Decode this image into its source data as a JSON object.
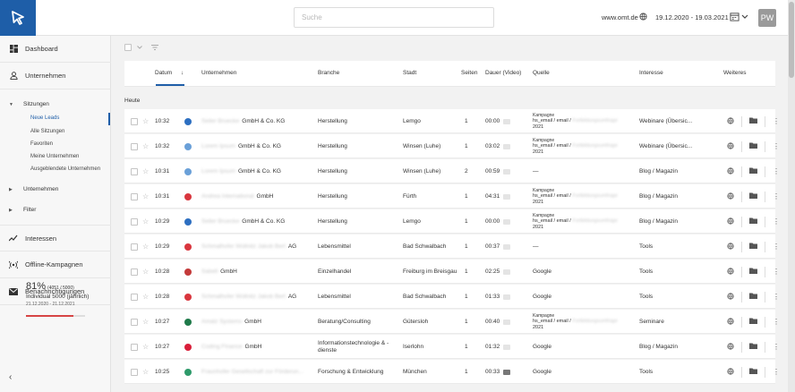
{
  "header": {
    "search_placeholder": "Suche",
    "site": "www.omt.de",
    "date_range": "19.12.2020 - 19.03.2021",
    "avatar_initials": "PW"
  },
  "sidebar": {
    "main_items": [
      {
        "label": "Dashboard",
        "icon": "dashboard-icon"
      },
      {
        "label": "Unternehmen",
        "icon": "person-icon"
      }
    ],
    "sitzungen": {
      "label": "Sitzungen",
      "items": [
        "Neue Leads",
        "Alle Sitzungen",
        "Favoriten",
        "Meine Unternehmen",
        "Ausgeblendete Unternehmen"
      ]
    },
    "unternehmen_sub": "Unternehmen",
    "filter": "Filter",
    "bottom_items": [
      {
        "label": "Interessen",
        "icon": "trend-icon"
      },
      {
        "label": "Offline-Kampagnen",
        "icon": "broadcast-icon"
      },
      {
        "label": "Benachrichtigungen",
        "icon": "mail-icon"
      }
    ],
    "quota": {
      "percent": "81%",
      "count": "(4051 / 5000)",
      "plan": "Individual 5000 (jährlich)",
      "dates": "21.12.2020 - 21.12.2021",
      "fill_fraction": 0.81
    },
    "collapse_glyph": "‹"
  },
  "table": {
    "columns": [
      "Datum",
      "Unternehmen",
      "Branche",
      "Stadt",
      "Seiten",
      "Dauer (Video)",
      "Quelle",
      "Interesse",
      "Weiteres"
    ],
    "sort_arrow": "↓",
    "group_label": "Heute",
    "quelle_kampagne": "Kampagne",
    "quelle_line": "hs_email / email /",
    "quelle_hidden": "Fortbildungsumfrage",
    "quelle_year": "2021",
    "rows": [
      {
        "time": "10:32",
        "name_hidden": "Seiler Bruecke",
        "suffix": "GmbH & Co. KG",
        "branche": "Herstellung",
        "stadt": "Lemgo",
        "seiten": "1",
        "dauer": "00:00",
        "quelle": "",
        "interesse": "Webinare (Übersic...",
        "logo": "#2d6fc1",
        "video_dark": false
      },
      {
        "time": "10:32",
        "name_hidden": "Lorem Ipsum",
        "suffix": "GmbH & Co. KG",
        "branche": "Herstellung",
        "stadt": "Winsen (Luhe)",
        "seiten": "1",
        "dauer": "03:02",
        "quelle": "",
        "interesse": "Webinare (Übersic...",
        "logo": "#6aa0d8",
        "video_dark": false
      },
      {
        "time": "10:31",
        "name_hidden": "Lorem Ipsum",
        "suffix": "GmbH & Co. KG",
        "branche": "Herstellung",
        "stadt": "Winsen (Luhe)",
        "seiten": "2",
        "dauer": "00:59",
        "quelle": "—",
        "interesse": "Blog / Magazin",
        "logo": "#6aa0d8",
        "video_dark": false
      },
      {
        "time": "10:31",
        "name_hidden": "Andrea International",
        "suffix": "GmbH",
        "branche": "Herstellung",
        "stadt": "Fürth",
        "seiten": "1",
        "dauer": "04:31",
        "quelle": "",
        "interesse": "Blog / Magazin",
        "logo": "#d9363e",
        "video_dark": false
      },
      {
        "time": "10:29",
        "name_hidden": "Seiler Bruecke",
        "suffix": "GmbH & Co. KG",
        "branche": "Herstellung",
        "stadt": "Lemgo",
        "seiten": "1",
        "dauer": "00:00",
        "quelle": "",
        "interesse": "Blog / Magazin",
        "logo": "#2d6fc1",
        "video_dark": false
      },
      {
        "time": "10:29",
        "name_hidden": "Schmalhofer Wollnitz Jakob Bert",
        "suffix": "AG",
        "branche": "Lebensmittel",
        "stadt": "Bad Schwalbach",
        "seiten": "1",
        "dauer": "00:37",
        "quelle": "—",
        "interesse": "Tools",
        "logo": "#d9363e",
        "video_dark": false
      },
      {
        "time": "10:28",
        "name_hidden": "Sabell",
        "suffix": "GmbH",
        "branche": "Einzelhandel",
        "stadt": "Freiburg im Breisgau",
        "seiten": "1",
        "dauer": "02:25",
        "quelle": "Google",
        "interesse": "Tools",
        "logo": "#c43a3a",
        "video_dark": false
      },
      {
        "time": "10:28",
        "name_hidden": "Schmalhofer Wollnitz Jakob Bert",
        "suffix": "AG",
        "branche": "Lebensmittel",
        "stadt": "Bad Schwalbach",
        "seiten": "1",
        "dauer": "01:33",
        "quelle": "Google",
        "interesse": "Tools",
        "logo": "#d9363e",
        "video_dark": false
      },
      {
        "time": "10:27",
        "name_hidden": "Amatz Systems",
        "suffix": "GmbH",
        "branche": "Beratung/Consulting",
        "stadt": "Gütersloh",
        "seiten": "1",
        "dauer": "00:40",
        "quelle": "",
        "interesse": "Seminare",
        "logo": "#1f7a4a",
        "video_dark": false
      },
      {
        "time": "10:27",
        "name_hidden": "Coding Finance",
        "suffix": "GmbH",
        "branche": "Informationstechnologie & -dienste",
        "stadt": "Iserlohn",
        "seiten": "1",
        "dauer": "01:32",
        "quelle": "Google",
        "interesse": "Blog / Magazin",
        "logo": "#d91f3a",
        "video_dark": false
      },
      {
        "time": "10:25",
        "name_hidden": "Fraunhofer Gesellschaft zur Förderun...",
        "suffix": "",
        "branche": "Forschung & Entwicklung",
        "stadt": "München",
        "seiten": "1",
        "dauer": "00:33",
        "quelle": "Google",
        "interesse": "Tools",
        "logo": "#2e9a6a",
        "video_dark": true
      }
    ]
  },
  "colors": {
    "brand": "#1e5ea8",
    "quota_fill": "#d64545"
  }
}
